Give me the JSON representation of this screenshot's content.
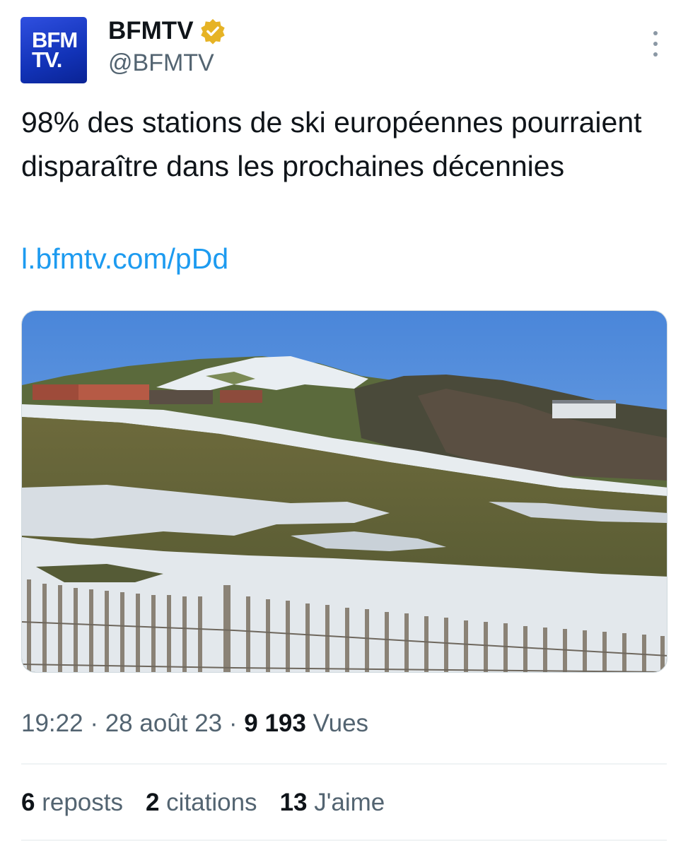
{
  "author": {
    "avatar_line1": "BFM",
    "avatar_line2": "TV.",
    "name": "BFMTV",
    "handle": "@BFMTV"
  },
  "tweet": {
    "text": "98% des stations de ski européennes pourraient disparaître dans les prochaines décennies",
    "link": "l.bfmtv.com/pDd"
  },
  "meta": {
    "time": "19:22",
    "sep1": " · ",
    "date": "28 août 23",
    "sep2": " · ",
    "views_count": "9 193",
    "views_label": " Vues"
  },
  "stats": {
    "reposts_count": "6",
    "reposts_label": " reposts",
    "quotes_count": "2",
    "quotes_label": " citations",
    "likes_count": "13",
    "likes_label": " J'aime"
  },
  "colors": {
    "link": "#1d9bf0",
    "verified_badge": "#e6b325",
    "secondary_text": "#536471"
  },
  "icons": {
    "verified": "verified-badge-icon",
    "more": "more-options-icon"
  }
}
